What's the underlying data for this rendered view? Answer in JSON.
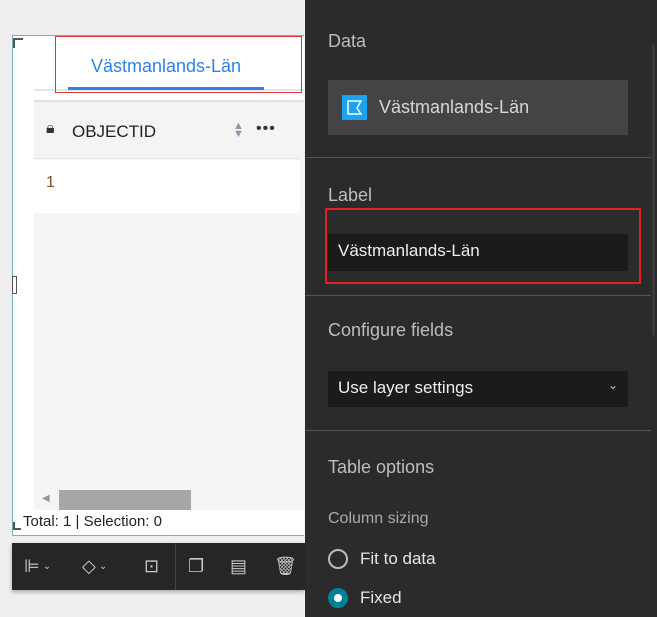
{
  "widget": {
    "tab_label": "Västmanlands-Län",
    "table": {
      "columns": [
        {
          "name": "OBJECTID",
          "locked": true
        }
      ],
      "rows": [
        [
          "1"
        ]
      ]
    },
    "footer": "Total: 1 | Selection: 0"
  },
  "toolbar": {
    "icons": [
      "align-icon",
      "layers-icon",
      "unlock-icon",
      "duplicate-icon",
      "edit-note-icon",
      "delete-icon"
    ]
  },
  "panel": {
    "data_heading": "Data",
    "data_source": "Västmanlands-Län",
    "label_heading": "Label",
    "label_value": "Västmanlands-Län",
    "configure_heading": "Configure fields",
    "configure_value": "Use layer settings",
    "table_options_heading": "Table options",
    "column_sizing_heading": "Column sizing",
    "options": [
      {
        "label": "Fit to data",
        "selected": false
      },
      {
        "label": "Fixed",
        "selected": true
      }
    ]
  },
  "colors": {
    "accent": "#2f80e8",
    "radio": "#00819a",
    "highlight": "#e01f26"
  }
}
